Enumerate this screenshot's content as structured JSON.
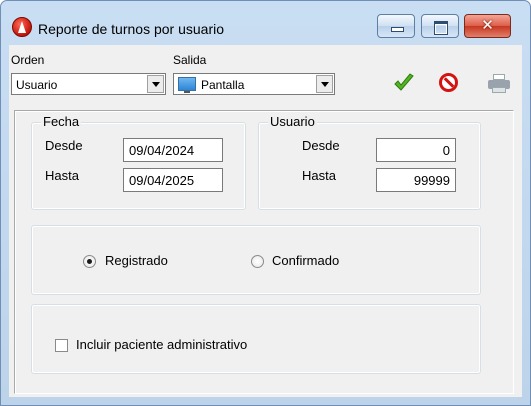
{
  "window": {
    "title": "Reporte de turnos por usuario",
    "close_glyph": "✕"
  },
  "toolbar": {
    "orden_label": "Orden",
    "orden_value": "Usuario",
    "salida_label": "Salida",
    "salida_value": "Pantalla",
    "icons": [
      "check-icon",
      "cancel-icon",
      "printer-icon"
    ]
  },
  "fecha_group": {
    "legend": "Fecha",
    "desde_label": "Desde",
    "desde_value": "09/04/2024",
    "hasta_label": "Hasta",
    "hasta_value": "09/04/2025"
  },
  "usuario_group": {
    "legend": "Usuario",
    "desde_label": "Desde",
    "desde_value": "0",
    "hasta_label": "Hasta",
    "hasta_value": "99999"
  },
  "estado_group": {
    "options": [
      "Registrado",
      "Confirmado"
    ],
    "selected": "Registrado",
    "registrado_label": "Registrado",
    "confirmado_label": "Confirmado"
  },
  "opciones_group": {
    "checkbox_label": "Incluir paciente administrativo",
    "checked": false
  },
  "colors": {
    "accept": "#52b522",
    "cancel": "#d41212",
    "frame": "#c9def3"
  }
}
